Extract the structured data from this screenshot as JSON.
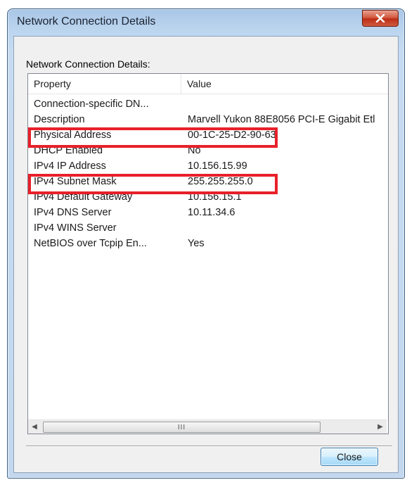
{
  "window": {
    "title": "Network Connection Details",
    "close_icon": "close-icon"
  },
  "group_label": "Network Connection Details:",
  "list": {
    "headers": {
      "property": "Property",
      "value": "Value"
    },
    "rows": [
      {
        "property": "Connection-specific DN...",
        "value": ""
      },
      {
        "property": "Description",
        "value": "Marvell Yukon 88E8056 PCI-E Gigabit Etl"
      },
      {
        "property": "Physical Address",
        "value": "00-1C-25-D2-90-63"
      },
      {
        "property": "DHCP Enabled",
        "value": "No"
      },
      {
        "property": "IPv4 IP Address",
        "value": "10.156.15.99"
      },
      {
        "property": "IPv4 Subnet Mask",
        "value": "255.255.255.0"
      },
      {
        "property": "IPv4 Default Gateway",
        "value": "10.156.15.1"
      },
      {
        "property": "IPv4 DNS Server",
        "value": "10.11.34.6"
      },
      {
        "property": "IPv4 WINS Server",
        "value": ""
      },
      {
        "property": "NetBIOS over Tcpip En...",
        "value": "Yes"
      }
    ],
    "highlight_color": "#e8202a"
  },
  "scrollbar": {
    "left_arrow": "◀",
    "right_arrow": "▶",
    "thumb_grip": "III"
  },
  "buttons": {
    "close_label": "Close"
  }
}
